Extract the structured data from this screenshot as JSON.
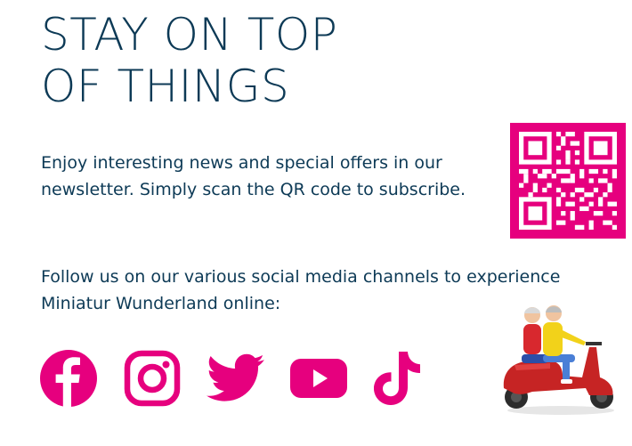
{
  "title": {
    "line1": "STAY ON TOP",
    "line2": "OF THINGS"
  },
  "intro_text": "Enjoy interesting news and special offers in our newsletter. Simply scan the QR code to subscribe.",
  "follow_text": "Follow us on our various social media channels to experience Miniatur Wunderland online:",
  "social_icons": [
    "facebook-icon",
    "instagram-icon",
    "twitter-icon",
    "youtube-icon",
    "tiktok-icon"
  ],
  "colors": {
    "accent": "#e6007e",
    "text": "#0d3a56",
    "background": "#ffffff"
  }
}
